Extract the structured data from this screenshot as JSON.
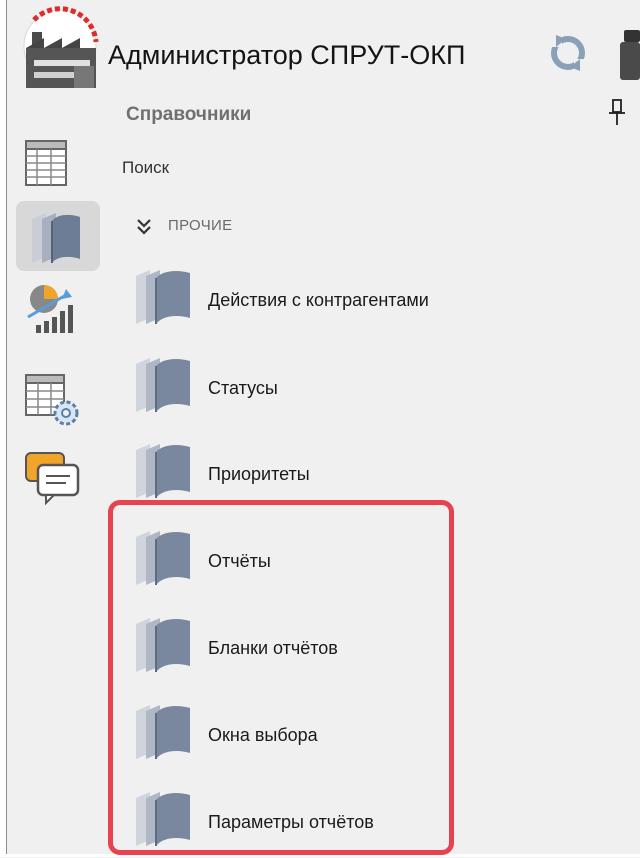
{
  "header": {
    "app_title": "Администратор СПРУТ-ОКП"
  },
  "panel": {
    "title": "Справочники",
    "search_placeholder": "Поиск"
  },
  "group": {
    "label": "ПРОЧИЕ"
  },
  "items": [
    {
      "label": "Действия с контрагентами"
    },
    {
      "label": "Статусы"
    },
    {
      "label": "Приоритеты"
    },
    {
      "label": "Отчёты"
    },
    {
      "label": "Бланки отчётов"
    },
    {
      "label": "Окна выбора"
    },
    {
      "label": "Параметры отчётов"
    }
  ],
  "icons": {
    "logo": "factory-logo-icon",
    "refresh": "refresh-icon",
    "rail": [
      "table-icon",
      "books-icon",
      "analytics-icon",
      "table-settings-icon",
      "messages-icon"
    ],
    "item": "book-icon"
  },
  "colors": {
    "highlight": "#e8414f",
    "active_indicator": "#2f7bd6",
    "background": "#f0f0f0"
  }
}
